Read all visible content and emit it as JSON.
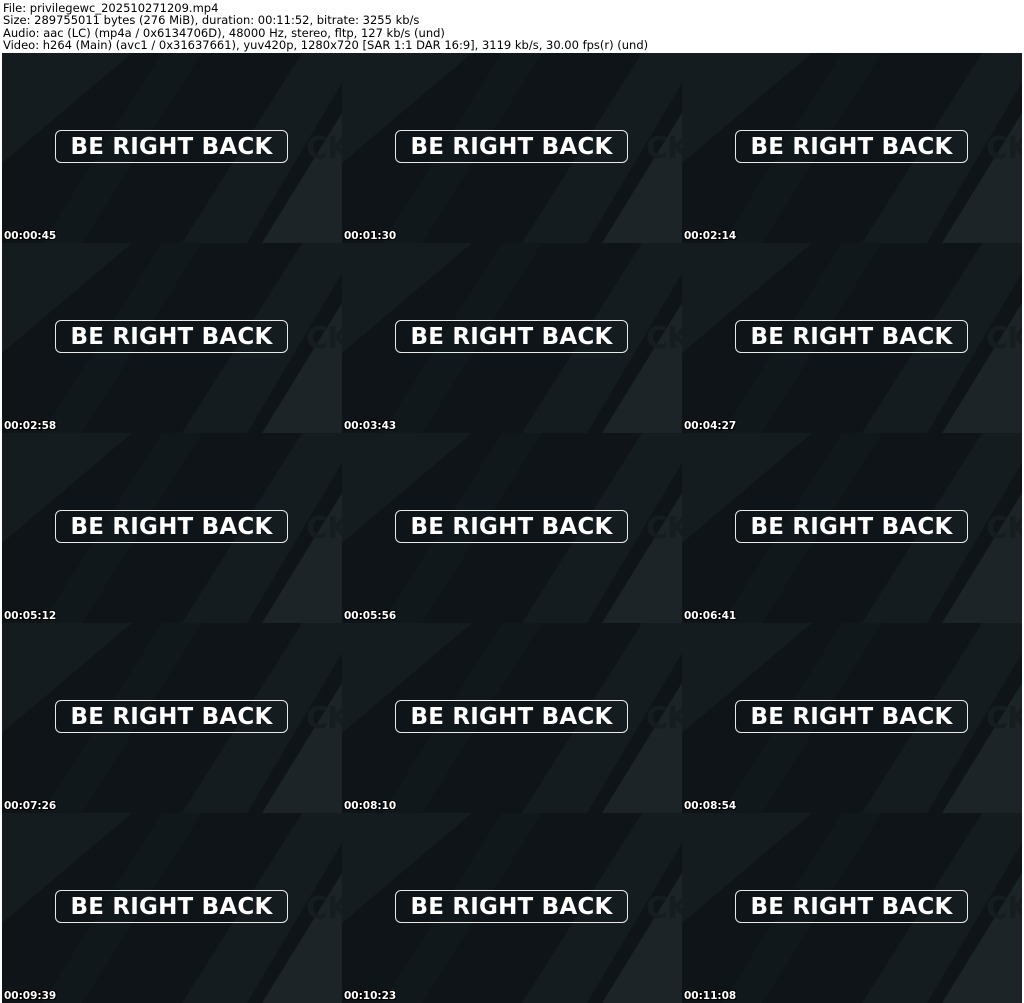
{
  "header": {
    "file_line": "File: privilegewc_202510271209.mp4",
    "size_line": "Size: 289755011 bytes (276 MiB), duration: 00:11:52, bitrate: 3255 kb/s",
    "audio_line": "Audio: aac (LC) (mp4a / 0x6134706D), 48000 Hz, stereo, fltp, 127 kb/s (und)",
    "video_line": "Video: h264 (Main) (avc1 / 0x31637661), yuv420p, 1280x720 [SAR 1:1 DAR 16:9], 3119 kb/s, 30.00 fps(r) (und)"
  },
  "frames": [
    {
      "overlay": "BE RIGHT BACK",
      "timestamp": "00:00:45"
    },
    {
      "overlay": "BE RIGHT BACK",
      "timestamp": "00:01:30"
    },
    {
      "overlay": "BE RIGHT BACK",
      "timestamp": "00:02:14"
    },
    {
      "overlay": "BE RIGHT BACK",
      "timestamp": "00:02:58"
    },
    {
      "overlay": "BE RIGHT BACK",
      "timestamp": "00:03:43"
    },
    {
      "overlay": "BE RIGHT BACK",
      "timestamp": "00:04:27"
    },
    {
      "overlay": "BE RIGHT BACK",
      "timestamp": "00:05:12"
    },
    {
      "overlay": "BE RIGHT BACK",
      "timestamp": "00:05:56"
    },
    {
      "overlay": "BE RIGHT BACK",
      "timestamp": "00:06:41"
    },
    {
      "overlay": "BE RIGHT BACK",
      "timestamp": "00:07:26"
    },
    {
      "overlay": "BE RIGHT BACK",
      "timestamp": "00:08:10"
    },
    {
      "overlay": "BE RIGHT BACK",
      "timestamp": "00:08:54"
    },
    {
      "overlay": "BE RIGHT BACK",
      "timestamp": "00:09:39"
    },
    {
      "overlay": "BE RIGHT BACK",
      "timestamp": "00:10:23"
    },
    {
      "overlay": "BE RIGHT BACK",
      "timestamp": "00:11:08"
    }
  ],
  "ghost_text": "CK",
  "colors": {
    "frame_background": "#0e1417",
    "stripe_light": "#1c2428",
    "stripe_mid": "#151c20",
    "badge_border": "#e9e9e9",
    "badge_text": "#ffffff"
  }
}
